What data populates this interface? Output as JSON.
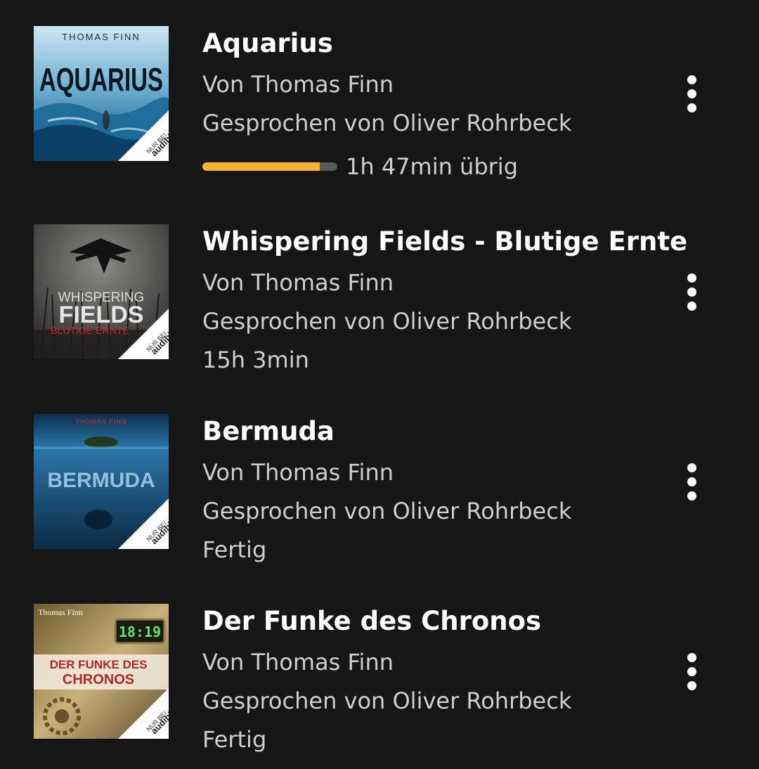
{
  "colors": {
    "background": "#161616",
    "progress_fill": "#f7b233",
    "progress_track": "#5a5a5a"
  },
  "items": [
    {
      "title": "Aquarius",
      "author": "Von Thomas Finn",
      "narrator": "Gesprochen von Oliver Rohrbeck",
      "progress": 0.87,
      "status": "1h 47min übrig",
      "cover": {
        "author_text": "THOMAS FINN",
        "title_text": "AQUARIUS",
        "badge_top": "NUR BEI",
        "badge_bottom": "audible"
      },
      "menu_icon": "more-vertical-icon"
    },
    {
      "title": "Whispering Fields - Blutige Ernte",
      "author": "Von Thomas Finn",
      "narrator": "Gesprochen von Oliver Rohrbeck",
      "status": "15h 3min",
      "cover": {
        "title_line1": "WHISPERING",
        "title_line2": "FIELDS",
        "subtitle": "BLUTIGE ERNTE",
        "badge_top": "NUR BEI",
        "badge_bottom": "audible"
      },
      "menu_icon": "more-vertical-icon"
    },
    {
      "title": "Bermuda",
      "author": "Von Thomas Finn",
      "narrator": "Gesprochen von Oliver Rohrbeck",
      "status": "Fertig",
      "cover": {
        "author_text": "THOMAS FINN",
        "title_text": "BERMUDA",
        "badge_top": "NUR BEI",
        "badge_bottom": "audible"
      },
      "menu_icon": "more-vertical-icon"
    },
    {
      "title": "Der Funke des Chronos",
      "author": "Von Thomas Finn",
      "narrator": "Gesprochen von Oliver Rohrbeck",
      "status": "Fertig",
      "cover": {
        "author_text": "Thomas Finn",
        "clock_text": "18:19",
        "title_line1": "DER FUNKE DES",
        "title_line2": "CHRONOS",
        "badge_top": "NUR BEI",
        "badge_bottom": "audible"
      },
      "menu_icon": "more-vertical-icon"
    }
  ]
}
